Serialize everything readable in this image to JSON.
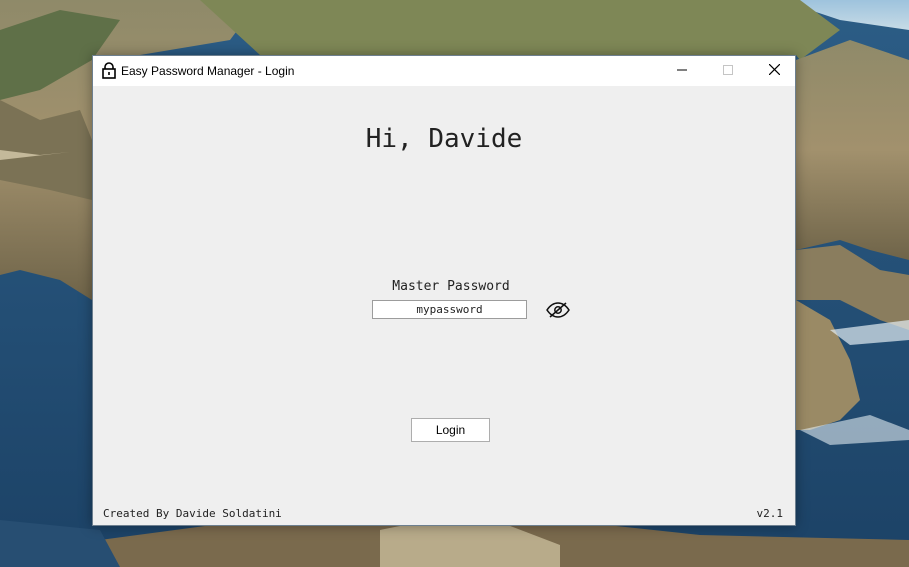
{
  "window": {
    "title": "Easy Password Manager - Login",
    "controls": {
      "minimize_icon": "minimize-icon",
      "maximize_icon": "maximize-icon",
      "close_icon": "close-icon"
    }
  },
  "greeting": "Hi, Davide",
  "password": {
    "label": "Master Password",
    "value": "mypassword",
    "toggle_icon": "eye-slash-icon"
  },
  "login_label": "Login",
  "footer": {
    "credit": "Created By Davide Soldatini",
    "version": "v2.1"
  },
  "colors": {
    "window_background": "#efefef",
    "titlebar_background": "#ffffff",
    "text": "#222222"
  }
}
